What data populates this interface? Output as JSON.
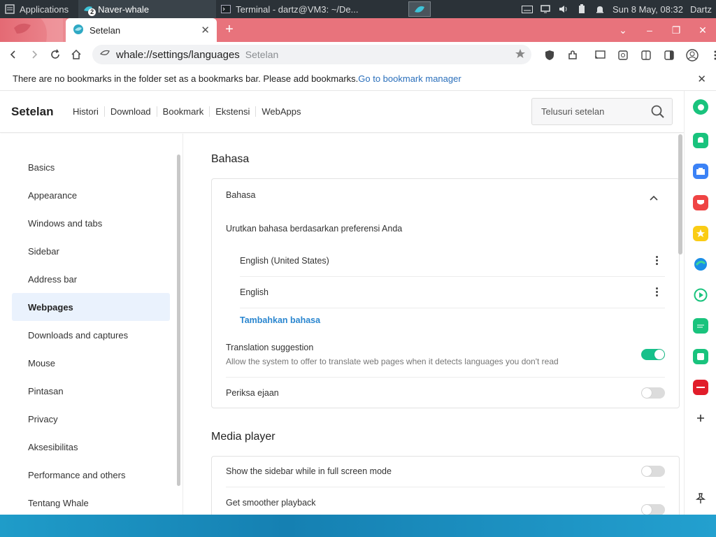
{
  "taskbar": {
    "apps_label": "Applications",
    "window1": "Naver-whale",
    "window1_badge": "2",
    "window2": "Terminal - dartz@VM3: ~/De...",
    "clock": "Sun  8 May, 08:32",
    "user": "Dartz"
  },
  "tab": {
    "title": "Setelan"
  },
  "omnibox": {
    "url": "whale://settings/languages",
    "suffix": "Setelan"
  },
  "bookmark_bar": {
    "message": "There are no bookmarks in the folder set as a bookmarks bar. Please add bookmarks.",
    "link": "Go to bookmark manager"
  },
  "settings_header": {
    "title": "Setelan",
    "nav": [
      "Histori",
      "Download",
      "Bookmark",
      "Ekstensi",
      "WebApps"
    ],
    "search_placeholder": "Telusuri setelan"
  },
  "sidebar": {
    "items": [
      "Basics",
      "Appearance",
      "Windows and tabs",
      "Sidebar",
      "Address bar",
      "Webpages",
      "Downloads and captures",
      "Mouse",
      "Pintasan",
      "Privacy",
      "Aksesibilitas",
      "Performance and others",
      "Tentang Whale"
    ],
    "active": "Webpages"
  },
  "languages": {
    "section_title": "Bahasa",
    "card_header": "Bahasa",
    "order_label": "Urutkan bahasa berdasarkan preferensi Anda",
    "items": [
      "English (United States)",
      "English"
    ],
    "add_label": "Tambahkan bahasa",
    "translation": {
      "title": "Translation suggestion",
      "desc": "Allow the system to offer to translate web pages when it detects languages you don't read",
      "enabled": true
    },
    "spellcheck": {
      "title": "Periksa ejaan",
      "enabled": false
    }
  },
  "media": {
    "section_title": "Media player",
    "fullscreen_sidebar": {
      "title": "Show the sidebar while in full screen mode",
      "enabled": false
    },
    "smoother": {
      "title": "Get smoother playback",
      "enabled": false
    }
  },
  "colors": {
    "tabstrip": "#e8737c",
    "toggle_on": "#17c08a",
    "link": "#2a6fbb",
    "active_nav": "#eaf2fd"
  }
}
